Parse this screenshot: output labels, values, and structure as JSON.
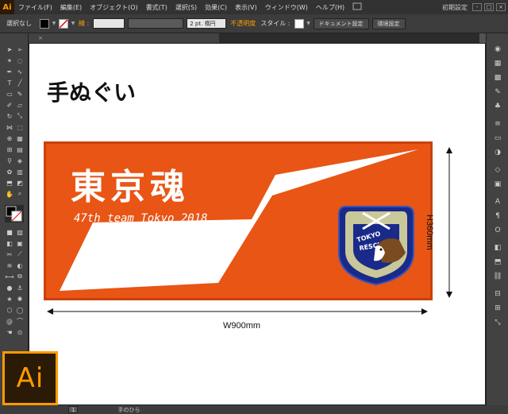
{
  "app": {
    "logo": "Ai"
  },
  "menu": {
    "items": [
      "ファイル(F)",
      "編集(E)",
      "オブジェクト(O)",
      "書式(T)",
      "選択(S)",
      "効果(C)",
      "表示(V)",
      "ウィンドウ(W)",
      "ヘルプ(H)"
    ],
    "bridge_icon": "bridge-icon",
    "workspace": "初期設定",
    "window_buttons": [
      "-",
      "□",
      "×"
    ]
  },
  "control_bar": {
    "selection": "選択なし",
    "stroke_label": "線 :",
    "stroke_weight": "2 pt. 楕円",
    "opacity_label": "不透明度",
    "style_label": "スタイル :",
    "document_settings": "ドキュメント設定",
    "preferences": "環境設定"
  },
  "document_tab": {
    "label": "",
    "close": "×"
  },
  "canvas": {
    "heading": "手ぬぐい",
    "towel": {
      "title": "東京魂",
      "subtitle": "47th team Tokyo 2018",
      "badge_top": "TOKYO",
      "badge_bottom": "RESCUE",
      "bg_color": "#e85515",
      "border_color": "#c9420a"
    },
    "width_label": "W900mm",
    "height_label": "H360mm"
  },
  "status": {
    "zoom": "1",
    "tool": "手のひら"
  },
  "brand_badge": "Ai",
  "colors": {
    "accent": "#ff9a00",
    "ui_dark": "#3c3c3c"
  }
}
